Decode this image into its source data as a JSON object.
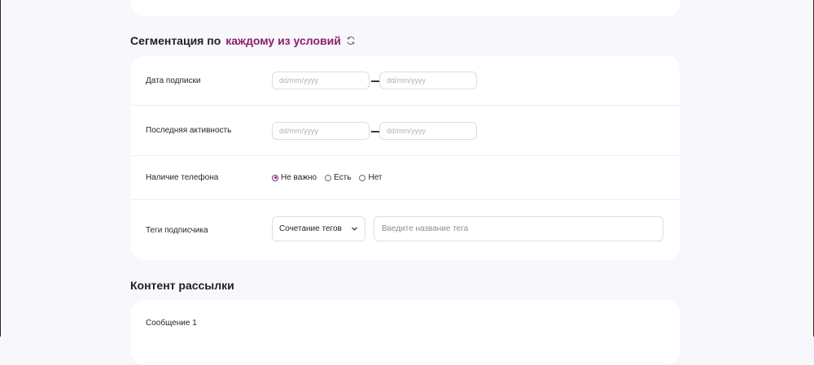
{
  "segmentation": {
    "title_prefix": "Сегментация по",
    "title_accent": "каждому из условий",
    "rows": {
      "subscription_date": {
        "label": "Дата подписки",
        "from_placeholder": "dd/mm/yyyy",
        "to_placeholder": "dd/mm/yyyy"
      },
      "last_activity": {
        "label": "Последняя активность",
        "from_placeholder": "dd/mm/yyyy",
        "to_placeholder": "dd/mm/yyyy"
      },
      "phone": {
        "label": "Наличие телефона",
        "options": [
          "Не важно",
          "Есть",
          "Нет"
        ],
        "selected": "Не важно"
      },
      "tags": {
        "label": "Теги подписчика",
        "select_value": "Сочетание тегов",
        "input_placeholder": "Введите название тега"
      }
    }
  },
  "content": {
    "title": "Контент рассылки",
    "message_label": "Сообщение 1"
  },
  "colors": {
    "accent": "#8a1f6f",
    "background": "#f8f7fb",
    "card": "#ffffff"
  },
  "icons": {
    "refresh": "refresh-icon",
    "chevron": "chevron-down-icon"
  }
}
